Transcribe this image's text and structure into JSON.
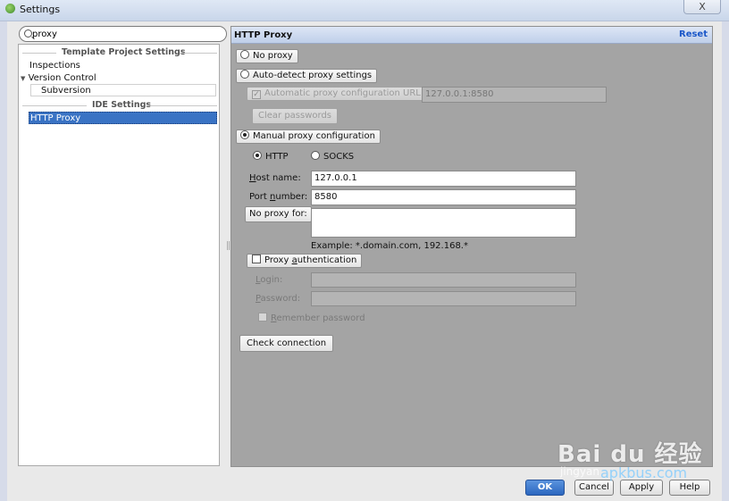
{
  "window": {
    "title": "Settings",
    "close_glyph": "X"
  },
  "search": {
    "value": "proxy"
  },
  "tree": {
    "group_template": "Template Project Settings",
    "inspections": "Inspections",
    "version_control": "Version Control",
    "version_control_arrow": "▼",
    "subversion": "Subversion",
    "group_ide": "IDE Settings",
    "http_proxy": "HTTP Proxy"
  },
  "panel": {
    "title": "HTTP Proxy",
    "reset": "Reset",
    "no_proxy": "No proxy",
    "auto_detect": "Auto-detect proxy settings",
    "auto_config_url_label": "Automatic proxy configuration URL:",
    "auto_config_url_value": "127.0.0.1:8580",
    "clear_passwords": "Clear passwords",
    "manual_config": "Manual proxy configuration",
    "http": "HTTP",
    "socks": "SOCKS",
    "host_name_label_pre": "H",
    "host_name_label_post": "ost name:",
    "host_name_value": "127.0.0.1",
    "port_label_pre": "Port ",
    "port_label_u": "n",
    "port_label_post": "umber:",
    "port_value": "8580",
    "no_proxy_for_label": "No proxy for:",
    "no_proxy_for_value": "",
    "example": "Example: *.domain.com, 192.168.*",
    "proxy_auth_pre": "Proxy ",
    "proxy_auth_u": "a",
    "proxy_auth_post": "uthentication",
    "login_label_pre": "",
    "login_label_u": "L",
    "login_label_post": "ogin:",
    "password_label_u": "P",
    "password_label_post": "assword:",
    "remember_password_u": "R",
    "remember_password_post": "emember password",
    "check_connection": "Check connection"
  },
  "buttons": {
    "ok": "OK",
    "cancel": "Cancel",
    "apply": "Apply",
    "help": "Help"
  },
  "watermark": {
    "brand": "Bai du 经验",
    "sub": "jingyan",
    "site": "apkbus.com"
  },
  "colors": {
    "accent": "#3a73c4",
    "reset_link": "#1a57c8"
  }
}
